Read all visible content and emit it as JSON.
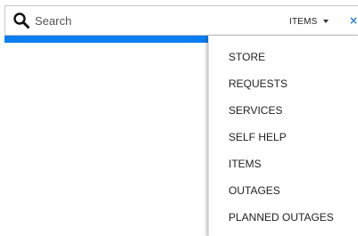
{
  "search": {
    "placeholder": "Search",
    "value": "",
    "icon": "search-icon"
  },
  "scope": {
    "selected": "ITEMS",
    "icon": "caret-down-icon"
  },
  "close": {
    "glyph": "×",
    "icon": "close-icon"
  },
  "dropdown": {
    "items": [
      {
        "label": "STORE"
      },
      {
        "label": "REQUESTS"
      },
      {
        "label": "SERVICES"
      },
      {
        "label": "SELF HELP"
      },
      {
        "label": "ITEMS"
      },
      {
        "label": "OUTAGES"
      },
      {
        "label": "PLANNED OUTAGES"
      }
    ]
  },
  "colors": {
    "accent": "#0b7df0",
    "close": "#2a7fd4",
    "text": "#222222",
    "border": "#c9c9c9"
  }
}
